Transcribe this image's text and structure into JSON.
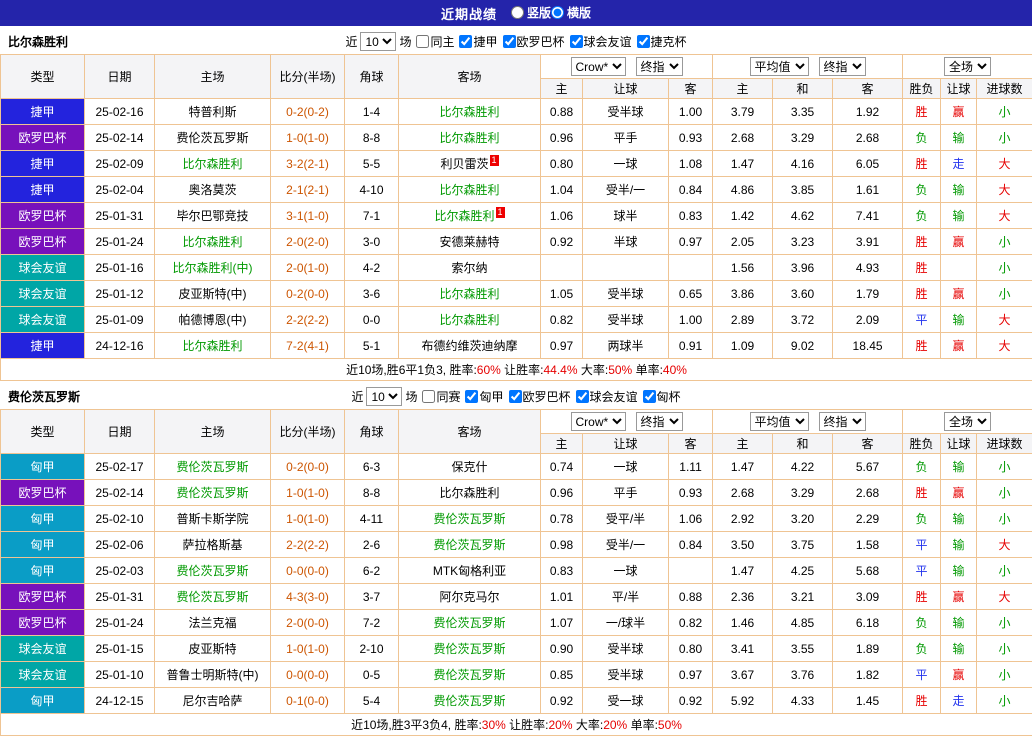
{
  "colors": {
    "topbar": "#2424aa",
    "border": "#efc493",
    "score": "#cc5500",
    "team_highlight": "#009900",
    "win": "#e60000",
    "lose": "#009900",
    "draw": "#2233ee",
    "league": {
      "捷甲": "#2323dd",
      "欧罗巴杯": "#7711bb",
      "球会友谊": "#00a6a6",
      "匈甲": "#0a9dc6"
    }
  },
  "topbar": {
    "title": "近期战绩",
    "radios": [
      {
        "label": "竖版",
        "checked": false
      },
      {
        "label": "横版",
        "checked": true
      }
    ]
  },
  "table_headers": {
    "left": [
      "类型",
      "日期",
      "主场",
      "比分(半场)",
      "角球",
      "客场"
    ],
    "groups": [
      {
        "selects": [
          "Crow*",
          "终指"
        ],
        "subs": [
          "主",
          "让球",
          "客"
        ]
      },
      {
        "selects": [
          "平均值",
          "终指"
        ],
        "subs": [
          "主",
          "和",
          "客"
        ]
      },
      {
        "selects": [
          "全场"
        ],
        "subs": [
          "胜负",
          "让球",
          "进球数"
        ]
      }
    ]
  },
  "sections": [
    {
      "team": "比尔森胜利",
      "filter": {
        "near_label": "近",
        "count": "10",
        "unit_label": "场",
        "checkboxes": [
          {
            "label": "同主",
            "checked": false
          },
          {
            "label": "捷甲",
            "checked": true
          },
          {
            "label": "欧罗巴杯",
            "checked": true
          },
          {
            "label": "球会友谊",
            "checked": true
          },
          {
            "label": "捷克杯",
            "checked": true
          }
        ]
      },
      "rows": [
        {
          "league": "捷甲",
          "date": "25-02-16",
          "home": {
            "name": "特普利斯"
          },
          "score": "0-2(0-2)",
          "corner": "1-4",
          "away": {
            "name": "比尔森胜利",
            "hl": true
          },
          "odds": [
            "0.88",
            "受半球",
            "1.00"
          ],
          "avg": [
            "3.79",
            "3.35",
            "1.92"
          ],
          "results": [
            "胜",
            "赢",
            "小"
          ]
        },
        {
          "league": "欧罗巴杯",
          "date": "25-02-14",
          "home": {
            "name": "费伦茨瓦罗斯"
          },
          "score": "1-0(1-0)",
          "corner": "8-8",
          "away": {
            "name": "比尔森胜利",
            "hl": true
          },
          "odds": [
            "0.96",
            "平手",
            "0.93"
          ],
          "avg": [
            "2.68",
            "3.29",
            "2.68"
          ],
          "results": [
            "负",
            "输",
            "小"
          ]
        },
        {
          "league": "捷甲",
          "date": "25-02-09",
          "home": {
            "name": "比尔森胜利",
            "hl": true
          },
          "score": "3-2(2-1)",
          "corner": "5-5",
          "away": {
            "name": "利贝雷茨",
            "rc": "1"
          },
          "odds": [
            "0.80",
            "一球",
            "1.08"
          ],
          "avg": [
            "1.47",
            "4.16",
            "6.05"
          ],
          "results": [
            "胜",
            "走",
            "大"
          ]
        },
        {
          "league": "捷甲",
          "date": "25-02-04",
          "home": {
            "name": "奥洛莫茨"
          },
          "score": "2-1(2-1)",
          "corner": "4-10",
          "away": {
            "name": "比尔森胜利",
            "hl": true
          },
          "odds": [
            "1.04",
            "受半/一",
            "0.84"
          ],
          "avg": [
            "4.86",
            "3.85",
            "1.61"
          ],
          "results": [
            "负",
            "输",
            "大"
          ]
        },
        {
          "league": "欧罗巴杯",
          "date": "25-01-31",
          "home": {
            "name": "毕尔巴鄂竞技"
          },
          "score": "3-1(1-0)",
          "corner": "7-1",
          "away": {
            "name": "比尔森胜利",
            "hl": true,
            "rc": "1"
          },
          "odds": [
            "1.06",
            "球半",
            "0.83"
          ],
          "avg": [
            "1.42",
            "4.62",
            "7.41"
          ],
          "results": [
            "负",
            "输",
            "大"
          ]
        },
        {
          "league": "欧罗巴杯",
          "date": "25-01-24",
          "home": {
            "name": "比尔森胜利",
            "hl": true
          },
          "score": "2-0(2-0)",
          "corner": "3-0",
          "away": {
            "name": "安德莱赫特"
          },
          "odds": [
            "0.92",
            "半球",
            "0.97"
          ],
          "avg": [
            "2.05",
            "3.23",
            "3.91"
          ],
          "results": [
            "胜",
            "赢",
            "小"
          ]
        },
        {
          "league": "球会友谊",
          "date": "25-01-16",
          "home": {
            "name": "比尔森胜利(中)",
            "hl": true
          },
          "score": "2-0(1-0)",
          "corner": "4-2",
          "away": {
            "name": "索尔纳"
          },
          "odds": [
            "",
            "",
            ""
          ],
          "avg": [
            "1.56",
            "3.96",
            "4.93"
          ],
          "results": [
            "胜",
            "",
            "小"
          ]
        },
        {
          "league": "球会友谊",
          "date": "25-01-12",
          "home": {
            "name": "皮亚斯特(中)"
          },
          "score": "0-2(0-0)",
          "corner": "3-6",
          "away": {
            "name": "比尔森胜利",
            "hl": true
          },
          "odds": [
            "1.05",
            "受半球",
            "0.65"
          ],
          "avg": [
            "3.86",
            "3.60",
            "1.79"
          ],
          "results": [
            "胜",
            "赢",
            "小"
          ]
        },
        {
          "league": "球会友谊",
          "date": "25-01-09",
          "home": {
            "name": "帕德博恩(中)"
          },
          "score": "2-2(2-2)",
          "corner": "0-0",
          "away": {
            "name": "比尔森胜利",
            "hl": true
          },
          "odds": [
            "0.82",
            "受半球",
            "1.00"
          ],
          "avg": [
            "2.89",
            "3.72",
            "2.09"
          ],
          "results": [
            "平",
            "输",
            "大"
          ]
        },
        {
          "league": "捷甲",
          "date": "24-12-16",
          "home": {
            "name": "比尔森胜利",
            "hl": true
          },
          "score": "7-2(4-1)",
          "corner": "5-1",
          "away": {
            "name": "布德约维茨迪纳摩"
          },
          "odds": [
            "0.97",
            "两球半",
            "0.91"
          ],
          "avg": [
            "1.09",
            "9.02",
            "18.45"
          ],
          "results": [
            "胜",
            "赢",
            "大"
          ]
        }
      ],
      "summary": {
        "prefix": "近10场,胜6平1负3,",
        "stats": [
          {
            "label": "胜率:",
            "value": "60%"
          },
          {
            "label": "让胜率:",
            "value": "44.4%"
          },
          {
            "label": "大率:",
            "value": "50%"
          },
          {
            "label": "单率:",
            "value": "40%"
          }
        ]
      }
    },
    {
      "team": "费伦茨瓦罗斯",
      "filter": {
        "near_label": "近",
        "count": "10",
        "unit_label": "场",
        "checkboxes": [
          {
            "label": "同赛",
            "checked": false
          },
          {
            "label": "匈甲",
            "checked": true
          },
          {
            "label": "欧罗巴杯",
            "checked": true
          },
          {
            "label": "球会友谊",
            "checked": true
          },
          {
            "label": "匈杯",
            "checked": true
          }
        ]
      },
      "rows": [
        {
          "league": "匈甲",
          "date": "25-02-17",
          "home": {
            "name": "费伦茨瓦罗斯",
            "hl": true
          },
          "score": "0-2(0-0)",
          "corner": "6-3",
          "away": {
            "name": "保克什"
          },
          "odds": [
            "0.74",
            "一球",
            "1.11"
          ],
          "avg": [
            "1.47",
            "4.22",
            "5.67"
          ],
          "results": [
            "负",
            "输",
            "小"
          ]
        },
        {
          "league": "欧罗巴杯",
          "date": "25-02-14",
          "home": {
            "name": "费伦茨瓦罗斯",
            "hl": true
          },
          "score": "1-0(1-0)",
          "corner": "8-8",
          "away": {
            "name": "比尔森胜利"
          },
          "odds": [
            "0.96",
            "平手",
            "0.93"
          ],
          "avg": [
            "2.68",
            "3.29",
            "2.68"
          ],
          "results": [
            "胜",
            "赢",
            "小"
          ]
        },
        {
          "league": "匈甲",
          "date": "25-02-10",
          "home": {
            "name": "普斯卡斯学院"
          },
          "score": "1-0(1-0)",
          "corner": "4-11",
          "away": {
            "name": "费伦茨瓦罗斯",
            "hl": true
          },
          "odds": [
            "0.78",
            "受平/半",
            "1.06"
          ],
          "avg": [
            "2.92",
            "3.20",
            "2.29"
          ],
          "results": [
            "负",
            "输",
            "小"
          ]
        },
        {
          "league": "匈甲",
          "date": "25-02-06",
          "home": {
            "name": "萨拉格斯基"
          },
          "score": "2-2(2-2)",
          "corner": "2-6",
          "away": {
            "name": "费伦茨瓦罗斯",
            "hl": true
          },
          "odds": [
            "0.98",
            "受半/一",
            "0.84"
          ],
          "avg": [
            "3.50",
            "3.75",
            "1.58"
          ],
          "results": [
            "平",
            "输",
            "大"
          ]
        },
        {
          "league": "匈甲",
          "date": "25-02-03",
          "home": {
            "name": "费伦茨瓦罗斯",
            "hl": true
          },
          "score": "0-0(0-0)",
          "corner": "6-2",
          "away": {
            "name": "MTK匈格利亚"
          },
          "odds": [
            "0.83",
            "一球",
            ""
          ],
          "avg": [
            "1.47",
            "4.25",
            "5.68"
          ],
          "results": [
            "平",
            "输",
            "小"
          ]
        },
        {
          "league": "欧罗巴杯",
          "date": "25-01-31",
          "home": {
            "name": "费伦茨瓦罗斯",
            "hl": true
          },
          "score": "4-3(3-0)",
          "corner": "3-7",
          "away": {
            "name": "阿尔克马尔"
          },
          "odds": [
            "1.01",
            "平/半",
            "0.88"
          ],
          "avg": [
            "2.36",
            "3.21",
            "3.09"
          ],
          "results": [
            "胜",
            "赢",
            "大"
          ]
        },
        {
          "league": "欧罗巴杯",
          "date": "25-01-24",
          "home": {
            "name": "法兰克福"
          },
          "score": "2-0(0-0)",
          "corner": "7-2",
          "away": {
            "name": "费伦茨瓦罗斯",
            "hl": true
          },
          "odds": [
            "1.07",
            "一/球半",
            "0.82"
          ],
          "avg": [
            "1.46",
            "4.85",
            "6.18"
          ],
          "results": [
            "负",
            "输",
            "小"
          ]
        },
        {
          "league": "球会友谊",
          "date": "25-01-15",
          "home": {
            "name": "皮亚斯特"
          },
          "score": "1-0(1-0)",
          "corner": "2-10",
          "away": {
            "name": "费伦茨瓦罗斯",
            "hl": true
          },
          "odds": [
            "0.90",
            "受半球",
            "0.80"
          ],
          "avg": [
            "3.41",
            "3.55",
            "1.89"
          ],
          "results": [
            "负",
            "输",
            "小"
          ]
        },
        {
          "league": "球会友谊",
          "date": "25-01-10",
          "home": {
            "name": "普鲁士明斯特(中)"
          },
          "score": "0-0(0-0)",
          "corner": "0-5",
          "away": {
            "name": "费伦茨瓦罗斯",
            "hl": true
          },
          "odds": [
            "0.85",
            "受半球",
            "0.97"
          ],
          "avg": [
            "3.67",
            "3.76",
            "1.82"
          ],
          "results": [
            "平",
            "赢",
            "小"
          ]
        },
        {
          "league": "匈甲",
          "date": "24-12-15",
          "home": {
            "name": "尼尔吉哈萨"
          },
          "score": "0-1(0-0)",
          "corner": "5-4",
          "away": {
            "name": "费伦茨瓦罗斯",
            "hl": true
          },
          "odds": [
            "0.92",
            "受一球",
            "0.92"
          ],
          "avg": [
            "5.92",
            "4.33",
            "1.45"
          ],
          "results": [
            "胜",
            "走",
            "小"
          ]
        }
      ],
      "summary": {
        "prefix": "近10场,胜3平3负4,",
        "stats": [
          {
            "label": "胜率:",
            "value": "30%"
          },
          {
            "label": "让胜率:",
            "value": "20%"
          },
          {
            "label": "大率:",
            "value": "20%"
          },
          {
            "label": "单率:",
            "value": "50%"
          }
        ]
      }
    }
  ]
}
